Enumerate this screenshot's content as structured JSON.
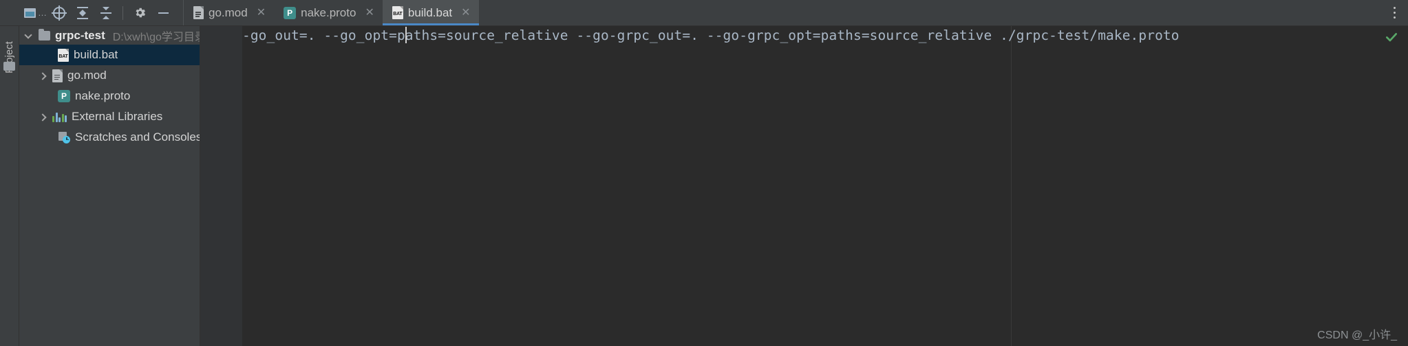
{
  "toolbar": {
    "buttons": [
      {
        "name": "select-opened-file",
        "icon": "window-icon",
        "label": ""
      },
      {
        "name": "locate-icon",
        "icon": "crosshair-target-icon",
        "label": ""
      },
      {
        "name": "expand-all",
        "icon": "expand-all-icon",
        "label": ""
      },
      {
        "name": "collapse-all",
        "icon": "collapse-all-icon",
        "label": ""
      },
      {
        "name": "settings",
        "icon": "gear-icon",
        "label": ""
      },
      {
        "name": "hide",
        "icon": "minus-icon",
        "label": ""
      }
    ],
    "overflow_label": "…",
    "more_options_label": "⋮"
  },
  "tabs": [
    {
      "label": "go.mod",
      "icon": "gomod-file-icon",
      "close": "✕",
      "active": false
    },
    {
      "label": "nake.proto",
      "icon": "proto-file-icon",
      "close": "✕",
      "active": false
    },
    {
      "label": "build.bat",
      "icon": "bat-file-icon",
      "close": "✕",
      "active": true
    }
  ],
  "tool_window": {
    "rail_label": "Project",
    "rail_icon": "folder-icon"
  },
  "project_tree": {
    "root": {
      "label": "grpc-test",
      "path": "D:\\xwh\\go学习目录\\gRPC\\grpc-test",
      "expanded": true,
      "icon": "folder-icon"
    },
    "items": [
      {
        "label": "build.bat",
        "icon": "bat-file-icon",
        "indent": 2,
        "selected": true,
        "chevron": "none"
      },
      {
        "label": "go.mod",
        "icon": "gomod-file-icon",
        "indent": 1,
        "selected": false,
        "chevron": "closed"
      },
      {
        "label": "nake.proto",
        "icon": "proto-file-icon",
        "indent": 2,
        "selected": false,
        "chevron": "none"
      },
      {
        "label": "External Libraries",
        "icon": "external-libraries-icon",
        "indent": 1,
        "selected": false,
        "chevron": "closed"
      },
      {
        "label": "Scratches and Consoles",
        "icon": "scratches-consoles-icon",
        "indent": 2,
        "selected": false,
        "chevron": "none"
      }
    ]
  },
  "editor": {
    "file": "build.bat",
    "line_text": "-go_out=. --go_opt=paths=source_relative --go-grpc_out=. --go-grpc_opt=paths=source_relative ./grpc-test/make.proto",
    "caret_column": 23,
    "inspection_status": "ok",
    "inspection_icon": "green-check-icon"
  },
  "watermark": {
    "text": "CSDN @_小许_"
  },
  "colors": {
    "accent": "#4a88c7",
    "selection": "#0d293e",
    "editor_bg": "#2b2b2b",
    "panel_bg": "#3c3f41",
    "text": "#a9b7c6",
    "muted": "#808080",
    "ok_green": "#59a869",
    "proto_teal": "#3f8e8b"
  }
}
